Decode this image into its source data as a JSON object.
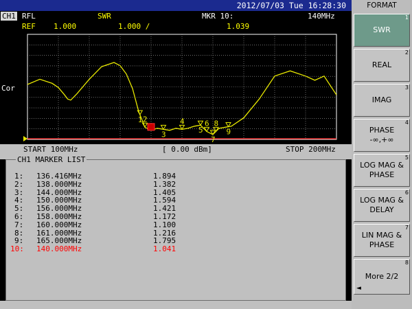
{
  "topbar": {
    "datetime": "2012/07/03 Tue 16:28:30"
  },
  "header": {
    "channel": "CH1",
    "measurement": "RFL",
    "format": "SWR",
    "marker_label": "MKR 10:",
    "marker_freq": "140MHz",
    "ref_label": "REF",
    "ref_value": "1.000",
    "scale": "1.000 /",
    "marker_value": "1.039"
  },
  "plot": {
    "side_label": "Cor"
  },
  "status": {
    "start": "START 100MHz",
    "power": "[ 0.00 dBm]",
    "stop": "STOP 200MHz"
  },
  "marker_list": {
    "title": "CH1 MARKER LIST",
    "rows": [
      {
        "index": "1:",
        "freq": "136.416MHz",
        "value": "1.894"
      },
      {
        "index": "2:",
        "freq": "138.000MHz",
        "value": "1.382"
      },
      {
        "index": "3:",
        "freq": "144.000MHz",
        "value": "1.405"
      },
      {
        "index": "4:",
        "freq": "150.000MHz",
        "value": "1.594"
      },
      {
        "index": "5:",
        "freq": "156.000MHz",
        "value": "1.421"
      },
      {
        "index": "6:",
        "freq": "158.000MHz",
        "value": "1.172"
      },
      {
        "index": "7:",
        "freq": "160.000MHz",
        "value": "1.100"
      },
      {
        "index": "8:",
        "freq": "161.000MHz",
        "value": "1.216"
      },
      {
        "index": "9:",
        "freq": "165.000MHz",
        "value": "1.795"
      },
      {
        "index": "10:",
        "freq": "140.000MHz",
        "value": "1.041",
        "active": true
      }
    ]
  },
  "softkeys": {
    "title": "FORMAT",
    "items": [
      {
        "line1": "SWR",
        "line2": "",
        "num": "1",
        "selected": true
      },
      {
        "line1": "REAL",
        "line2": "",
        "num": "2"
      },
      {
        "line1": "IMAG",
        "line2": "",
        "num": "3"
      },
      {
        "line1": "PHASE",
        "line2": "-∞,+∞",
        "num": "4"
      },
      {
        "line1": "LOG MAG &",
        "line2": "PHASE",
        "num": "5"
      },
      {
        "line1": "LOG MAG &",
        "line2": "DELAY",
        "num": "6"
      },
      {
        "line1": "LIN MAG &",
        "line2": "PHASE",
        "num": "7"
      },
      {
        "line1": "More 2/2",
        "line2": "",
        "num": "8",
        "arrow": "◄"
      }
    ]
  },
  "chart_data": {
    "type": "line",
    "x_range_mhz": [
      100,
      200
    ],
    "trace_color": "#e8e800",
    "trace_mhz": [
      100,
      104,
      108,
      110,
      112,
      113,
      114,
      116,
      120,
      124,
      128,
      130,
      132,
      134,
      136,
      138,
      140,
      142,
      144,
      146,
      148,
      150,
      152,
      154,
      156,
      158,
      160,
      161,
      162,
      164,
      166,
      170,
      175,
      180,
      185,
      190,
      193,
      196,
      200
    ],
    "trace_level": [
      0.52,
      0.57,
      0.53,
      0.49,
      0.42,
      0.38,
      0.37,
      0.43,
      0.57,
      0.69,
      0.73,
      0.7,
      0.62,
      0.48,
      0.26,
      0.11,
      0.08,
      0.1,
      0.09,
      0.08,
      0.1,
      0.09,
      0.1,
      0.12,
      0.13,
      0.07,
      0.04,
      0.07,
      0.1,
      0.11,
      0.12,
      0.2,
      0.38,
      0.6,
      0.65,
      0.6,
      0.56,
      0.6,
      0.42
    ],
    "markers": [
      {
        "label": "1",
        "mhz": 136.4
      },
      {
        "label": "2",
        "mhz": 138
      },
      {
        "label": "3",
        "mhz": 144
      },
      {
        "label": "4",
        "mhz": 150
      },
      {
        "label": "5",
        "mhz": 156
      },
      {
        "label": "6",
        "mhz": 158
      },
      {
        "label": "7",
        "mhz": 160
      },
      {
        "label": "8",
        "mhz": 161
      },
      {
        "label": "9",
        "mhz": 165
      }
    ],
    "active_marker_mhz": 140
  }
}
